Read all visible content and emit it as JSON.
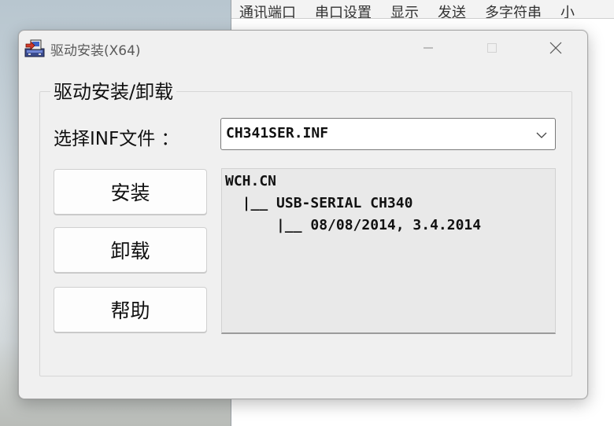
{
  "background_app": {
    "menu": [
      "通讯端口",
      "串口设置",
      "显示",
      "发送",
      "多字符串",
      "小"
    ]
  },
  "window": {
    "title": "驱动安装(X64)",
    "icon": "driver-install-icon",
    "controls": {
      "minimize": "—",
      "maximize": "□",
      "close": "✕"
    }
  },
  "group": {
    "legend": "驱动安装/卸载",
    "inf_label": "选择INF文件 ：",
    "inf_select": {
      "value": "CH341SER.INF",
      "icon": "chevron-down-icon"
    },
    "buttons": {
      "install": "安装",
      "uninstall": "卸载",
      "help": "帮助"
    },
    "info_lines": [
      "WCH.CN",
      "  |__ USB-SERIAL CH340",
      "      |__ 08/08/2014, 3.4.2014"
    ]
  }
}
